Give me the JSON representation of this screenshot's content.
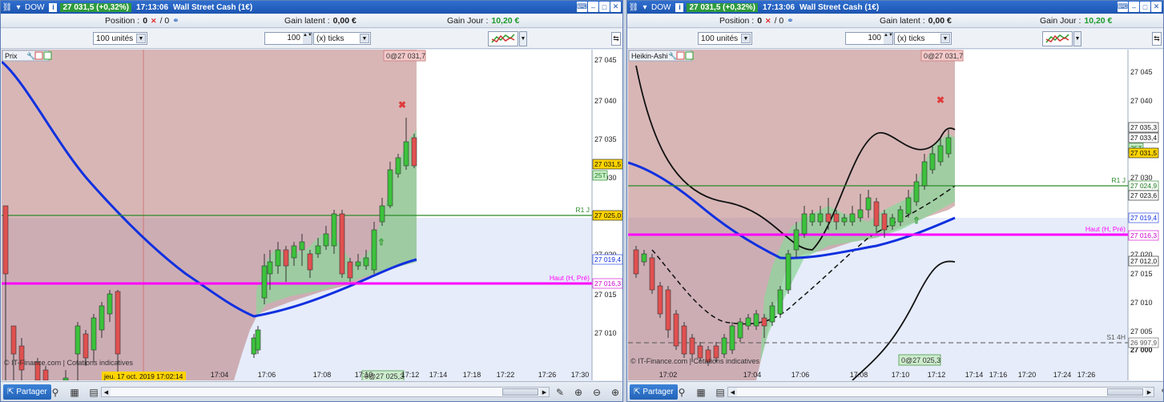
{
  "windows": [
    {
      "title": {
        "symbol": "DOW",
        "change": "27 031,5 (+0,32%)",
        "time": "17:13:06",
        "name": "Wall Street Cash (1€)"
      },
      "status": {
        "position_label": "Position :",
        "position_value": "0",
        "position_slash": "/ 0",
        "latent_label": "Gain latent :",
        "latent_value": "0,00 €",
        "jour_label": "Gain Jour :",
        "jour_value": "10,20 €"
      },
      "toolbar": {
        "units": "100 unités",
        "ticks_value": "100",
        "ticks_label": "(x) ticks"
      },
      "chart_label": "Prix",
      "top_tag": "0@27 031,7",
      "bottom_tag": "0@27 025,3",
      "watermark": "© IT-Finance.com | Cotations indicatives",
      "date_tag": "jeu. 17 oct. 2019 17:02:14",
      "price_ticks": [
        "27 045",
        "27 040",
        "27 035",
        "27 030",
        "27 025",
        "27 020",
        "27 015",
        "27 010"
      ],
      "time_ticks": [
        "17:04",
        "17:06",
        "17:08",
        "17:10",
        "17:12",
        "17:14",
        "17:18",
        "17:22",
        "17:26",
        "17:30"
      ],
      "line_labels": {
        "r1": "R1 J",
        "haut": "Haut (H, Pré)"
      },
      "price_badges": {
        "last": "27 031,5",
        "tag25": "25T",
        "r1": "27 025,0",
        "ma": "27 019,4",
        "haut": "27 016,3"
      },
      "colors": {
        "bull": "#3cc23c",
        "bear": "#e05050",
        "ma": "#1030e0",
        "haut": "#ff00ff",
        "r1": "#2a8a2a"
      }
    },
    {
      "title": {
        "symbol": "DOW",
        "change": "27 031,5 (+0,32%)",
        "time": "17:13:06",
        "name": "Wall Street Cash (1€)"
      },
      "status": {
        "position_label": "Position :",
        "position_value": "0",
        "position_slash": "/ 0",
        "latent_label": "Gain latent :",
        "latent_value": "0,00 €",
        "jour_label": "Gain Jour :",
        "jour_value": "10,20 €"
      },
      "toolbar": {
        "units": "100 unités",
        "ticks_value": "100",
        "ticks_label": "(x) ticks"
      },
      "chart_label": "Heikin-Ashi",
      "top_tag": "0@27 031,7",
      "bottom_tag": "0@27 025,3",
      "watermark": "© IT-Finance.com | Cotations indicatives",
      "price_ticks": [
        "27 045",
        "27 040",
        "27 035",
        "27 030",
        "27 025",
        "27 020",
        "27 015",
        "27 010",
        "27 005",
        "27 000"
      ],
      "time_ticks": [
        "17:02",
        "17:04",
        "17:06",
        "17:08",
        "17:10",
        "17:12",
        "17:14",
        "17:16",
        "17:20",
        "17:24",
        "17:26"
      ],
      "line_labels": {
        "r1": "R1 J",
        "haut": "Haut (H, Pré)",
        "s1": "S1 4H"
      },
      "price_badges": {
        "b1": "27 035,3",
        "b2": "27 033,4",
        "tag25": "25T",
        "last": "27 031,5",
        "r1": "27 024,9",
        "b3": "27 023,6",
        "ma": "27 019,4",
        "haut": "27 016,3",
        "b4": "27 012,0",
        "s1": "26 997,9"
      },
      "colors": {
        "bull": "#3cc23c",
        "bear": "#e05050",
        "ma": "#1030e0",
        "haut": "#ff00ff",
        "r1": "#2a8a2a"
      }
    }
  ],
  "bottom": {
    "share_label": "Partager"
  }
}
